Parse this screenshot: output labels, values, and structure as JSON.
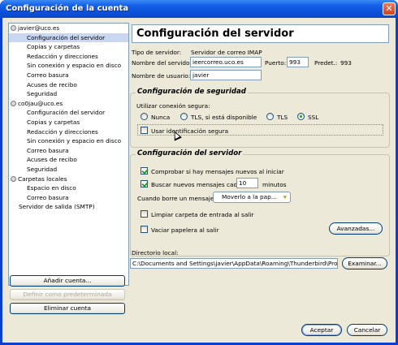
{
  "window": {
    "title": "Configuración de la cuenta",
    "close_glyph": "✕"
  },
  "tree": {
    "accounts": [
      {
        "name": "javier@uco.es",
        "items": [
          "Configuración del servidor",
          "Copias y carpetas",
          "Redacción y direcciones",
          "Sin conexión y espacio en disco",
          "Correo basura",
          "Acuses de recibo",
          "Seguridad"
        ]
      },
      {
        "name": "co0jau@uco.es",
        "items": [
          "Configuración del servidor",
          "Copias y carpetas",
          "Redacción y direcciones",
          "Sin conexión y espacio en disco",
          "Correo basura",
          "Acuses de recibo",
          "Seguridad"
        ]
      },
      {
        "name": "Carpetas locales",
        "items": [
          "Espacio en disco",
          "Correo basura"
        ]
      }
    ],
    "smtp": "Servidor de salida (SMTP)",
    "selected": "Configuración del servidor"
  },
  "left_buttons": {
    "add": "Añadir cuenta...",
    "default": "Definir como predeterminada",
    "remove": "Eliminar cuenta"
  },
  "panel": {
    "title": "Configuración del servidor",
    "server_type_label": "Tipo de servidor:",
    "server_type_value": "Servidor de correo IMAP",
    "server_name_label": "Nombre del servidor:",
    "server_name_value": "ieercorreo.uco.es",
    "port_label": "Puerto:",
    "port_value": "993",
    "default_label": "Predet.:",
    "default_value": "993",
    "username_label": "Nombre de usuario:",
    "username_value": "javier"
  },
  "security": {
    "title": "Configuración de seguridad",
    "use_secure_label": "Utilizar conexión segura:",
    "options": [
      "Nunca",
      "TLS, si está disponible",
      "TLS",
      "SSL"
    ],
    "selected": "SSL",
    "secure_auth_label": "Usar identificación segura"
  },
  "server_settings": {
    "title": "Configuración del servidor",
    "check_on_start": "Comprobar si hay mensajes nuevos al iniciar",
    "check_every": "Buscar nuevos mensajes cada",
    "minutes_value": "10",
    "minutes_label": "minutos",
    "delete_label": "Cuando borre un mensaje:",
    "delete_option": "Moverlo a la pap...",
    "clean_inbox": "Limpiar carpeta de entrada al salir",
    "empty_trash": "Vaciar papelera al salir",
    "advanced_button": "Avanzadas..."
  },
  "local_dir": {
    "label": "Directorio local:",
    "value": "C:\\Documents and Settings\\javier\\AppData\\Roaming\\Thunderbird\\Profiles\\xe",
    "browse_button": "Examinar..."
  },
  "dialog_buttons": {
    "ok": "Aceptar",
    "cancel": "Cancelar"
  },
  "colors": {
    "titlebar": "#0b4fd8",
    "dialog_bg": "#ece9d8",
    "selection": "#c9d7f2",
    "radio_dot": "#21a121"
  }
}
